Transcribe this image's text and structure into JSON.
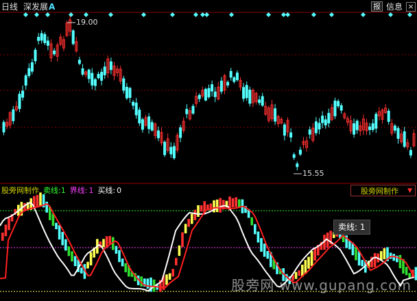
{
  "header": {
    "period": "日线",
    "market": "深发展",
    "market_tag": "A"
  },
  "topbar": {
    "icon_button": "报",
    "info_button": "信息",
    "close_button": "×"
  },
  "price_labels": {
    "high": "19.00",
    "low": "15.55"
  },
  "indicator": {
    "title": "股旁网制作",
    "sell_label": "卖线:",
    "sell_value": "1",
    "bound_label": "界线:",
    "bound_value": "1",
    "buy_label": "买线:",
    "buy_value": "0",
    "box_title": "股旁网制作",
    "box_arrow": "▼"
  },
  "tooltip": {
    "text": "卖线: 1"
  },
  "watermark": "股旁网 www.gupang.com",
  "colors": {
    "up": "#ff3030",
    "down": "#54ffff",
    "grid": "#8a0000",
    "marker": "#54ffff"
  }
}
